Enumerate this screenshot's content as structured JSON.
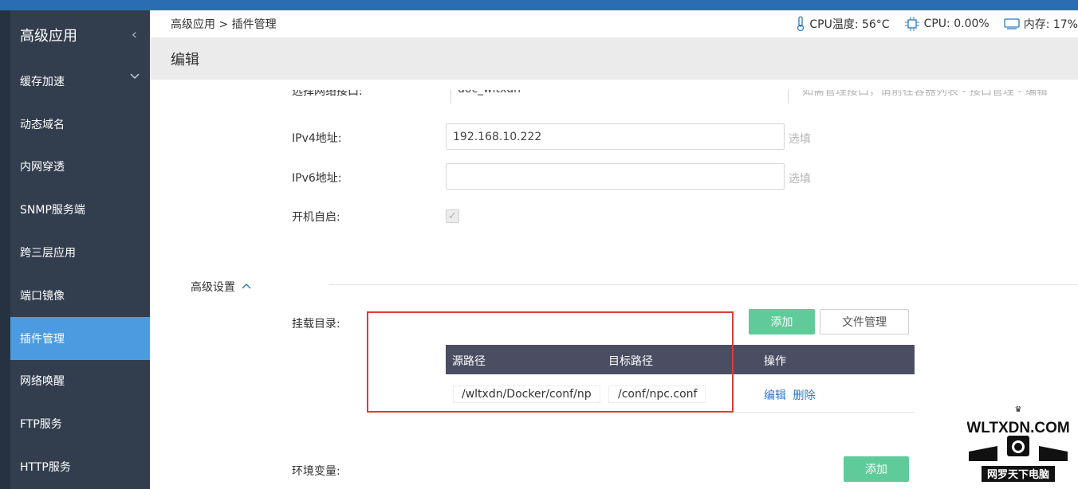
{
  "sidebar": {
    "title": "高级应用",
    "collapse_icon": "chevron-left-icon",
    "items": [
      {
        "label": "缓存加速",
        "has_submenu": true
      },
      {
        "label": "动态域名"
      },
      {
        "label": "内网穿透"
      },
      {
        "label": "SNMP服务端"
      },
      {
        "label": "跨三层应用"
      },
      {
        "label": "端口镜像"
      },
      {
        "label": "插件管理",
        "active": true
      },
      {
        "label": "网络唤醒"
      },
      {
        "label": "FTP服务"
      },
      {
        "label": "HTTP服务"
      }
    ]
  },
  "header": {
    "breadcrumb": "高级应用 > 插件管理",
    "cpu_temp": "CPU温度: 56°C",
    "cpu": "CPU: 0.00%",
    "memory": "内存: 17%"
  },
  "page": {
    "title": "编辑"
  },
  "form": {
    "interface_label": "选择网络接口:",
    "interface_value": "doc_wltxdn",
    "interface_hint": "如需管理接口，请前往容器列表 - 接口管理 - 编辑",
    "ipv4_label": "IPv4地址:",
    "ipv4_value": "192.168.10.222",
    "ipv4_hint": "选填",
    "ipv6_label": "IPv6地址:",
    "ipv6_value": "",
    "ipv6_hint": "选填",
    "autostart_label": "开机自启:",
    "autostart_checked": true
  },
  "advanced": {
    "title": "高级设置",
    "mount_label": "挂载目录:",
    "add_button": "添加",
    "file_manage_button": "文件管理",
    "table": {
      "headers": [
        "源路径",
        "目标路径",
        "操作"
      ],
      "rows": [
        {
          "src": "/wltxdn/Docker/conf/np",
          "dst": "/conf/npc.conf",
          "edit": "编辑",
          "delete": "删除"
        }
      ]
    },
    "env_label": "环境变量:",
    "env_add_button": "添加"
  },
  "watermark": {
    "text_top": "WLTXDN.COM",
    "text_bottom": "网罗天下电脑"
  },
  "colors": {
    "accent_blue": "#2a6db3",
    "sidebar_bg": "#323e4e",
    "sidebar_active": "#4c9be0",
    "button_green": "#5fcb9a",
    "table_header": "#4b4e62",
    "highlight_red": "#e03a3a"
  }
}
